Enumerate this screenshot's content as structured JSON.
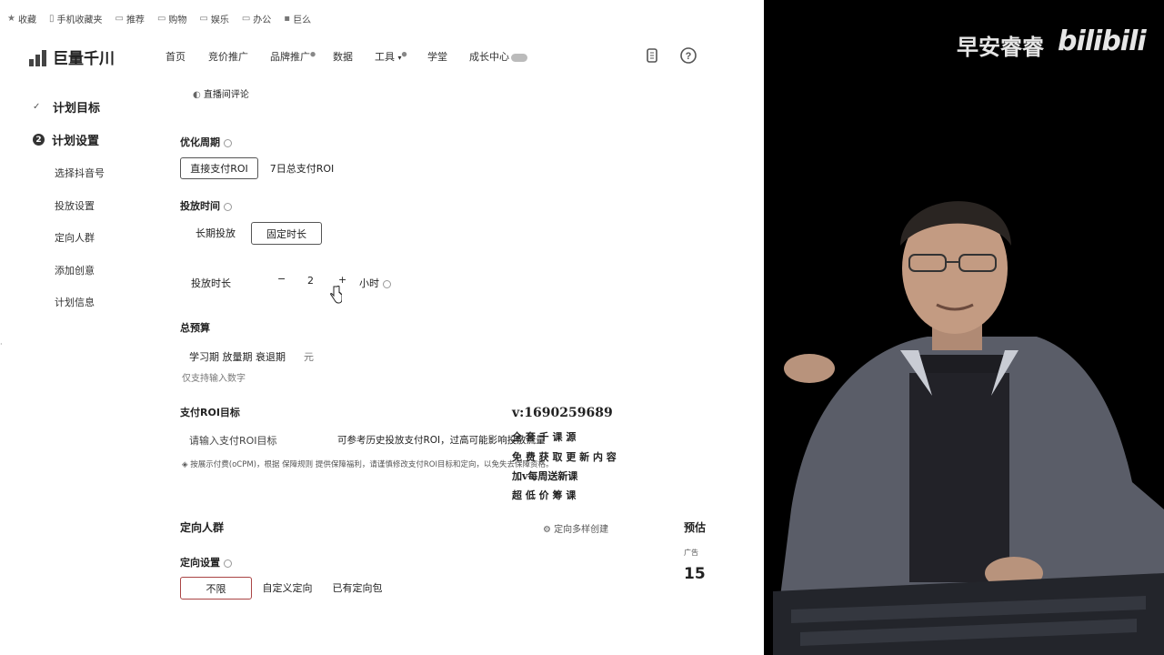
{
  "bookmarks": [
    {
      "icon": "star-icon",
      "label": "收藏"
    },
    {
      "icon": "phone-icon",
      "label": "手机收藏夹"
    },
    {
      "icon": "folder-icon",
      "label": "推荐"
    },
    {
      "icon": "folder-icon",
      "label": "购物"
    },
    {
      "icon": "folder-icon",
      "label": "娱乐"
    },
    {
      "icon": "folder-icon",
      "label": "办公"
    },
    {
      "icon": "app-icon",
      "label": "巨么"
    }
  ],
  "brand": {
    "name": "巨量千川"
  },
  "nav": {
    "home": "首页",
    "bidding": "竞价推广",
    "brand_promo": "品牌推广",
    "data": "数据",
    "tools": "工具",
    "academy": "学堂",
    "growth": "成长中心"
  },
  "sidebar": {
    "step1": "计划目标",
    "step2": "计划设置",
    "step2_num": "2",
    "sub": [
      "选择抖音号",
      "投放设置",
      "定向人群",
      "添加创意",
      "计划信息"
    ]
  },
  "form": {
    "live_comment": "直播间评论",
    "opt_period": {
      "label": "优化周期",
      "options": [
        "直接支付ROI",
        "7日总支付ROI"
      ],
      "selected": 0
    },
    "delivery_time": {
      "label": "投放时间",
      "options": [
        "长期投放",
        "固定时长"
      ],
      "selected": 1
    },
    "duration": {
      "label": "投放时长",
      "minus": "−",
      "value": "2",
      "plus": "+",
      "unit": "小时"
    },
    "budget": {
      "label": "总预算",
      "phases": "学习期  放量期  衰退期",
      "unit": "元",
      "hint": "仅支持输入数字"
    },
    "roi": {
      "label": "支付ROI目标",
      "placeholder": "请输入支付ROI目标",
      "tip": "可参考历史投放支付ROI，过高可能影响投放流量",
      "note": "按展示付费(oCPM)，根据 保障规则 提供保障福利，请谨慎修改支付ROI目标和定向，以免失去保障资格。"
    },
    "targeting": {
      "title": "定向人群",
      "multi": "定向多样创建",
      "settings_label": "定向设置",
      "options": [
        "不限",
        "自定义定向",
        "已有定向包"
      ],
      "selected": 0
    },
    "estimate": {
      "title": "预估",
      "ad": "广告",
      "value": "15"
    }
  },
  "overlay": {
    "wechat": "v:1690259689",
    "lines": [
      "全 套 千 课 源",
      "免 费 获 取 更 新 内 容",
      "加v每周送新课",
      "超 低 价 筹 课"
    ]
  },
  "streamer": {
    "name": "早安睿睿",
    "platform": "bilibili"
  }
}
